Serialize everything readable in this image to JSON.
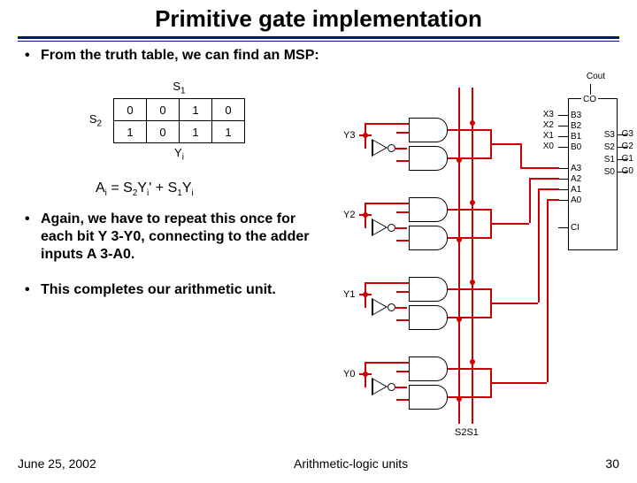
{
  "title": "Primitive gate implementation",
  "bullets": {
    "b1": "From the truth table, we can find an MSP:",
    "b2": "Again, we have to repeat this once for each bit Y 3-Y0, connecting to the adder inputs A 3-A0.",
    "b3": "This completes our arithmetic unit."
  },
  "kmap": {
    "top": "S",
    "top_sub": "1",
    "left": "S",
    "left_sub": "2",
    "bottom": "Y",
    "bottom_sub": "i",
    "cells": [
      [
        "0",
        "0",
        "1",
        "0"
      ],
      [
        "1",
        "0",
        "1",
        "1"
      ]
    ]
  },
  "equation": {
    "lhs_a": "A",
    "lhs_sub": "i",
    "eq": " = S",
    "s2sub": "2",
    "yprime": "Y",
    "ysub1": "i",
    "plus": " + S",
    "s1sub": "1",
    "y2": "Y",
    "ysub2": "i"
  },
  "circuit": {
    "cout_top": "Cout",
    "chip_top": "CO",
    "y_labels": [
      "Y3",
      "Y2",
      "Y1",
      "Y0"
    ],
    "pins_left": [
      "B3",
      "B2",
      "B1",
      "B0",
      "A3",
      "A2",
      "A1",
      "A0",
      "CI"
    ],
    "ext_left": [
      "X3",
      "X2",
      "X1",
      "X0"
    ],
    "pins_right": [
      "S3",
      "S2",
      "S1",
      "S0"
    ],
    "ext_right": [
      "G3",
      "G2",
      "G1",
      "G0"
    ],
    "s_labels": "S2S1"
  },
  "footer": {
    "date": "June 25, 2002",
    "center": "Arithmetic-logic units",
    "page": "30"
  }
}
